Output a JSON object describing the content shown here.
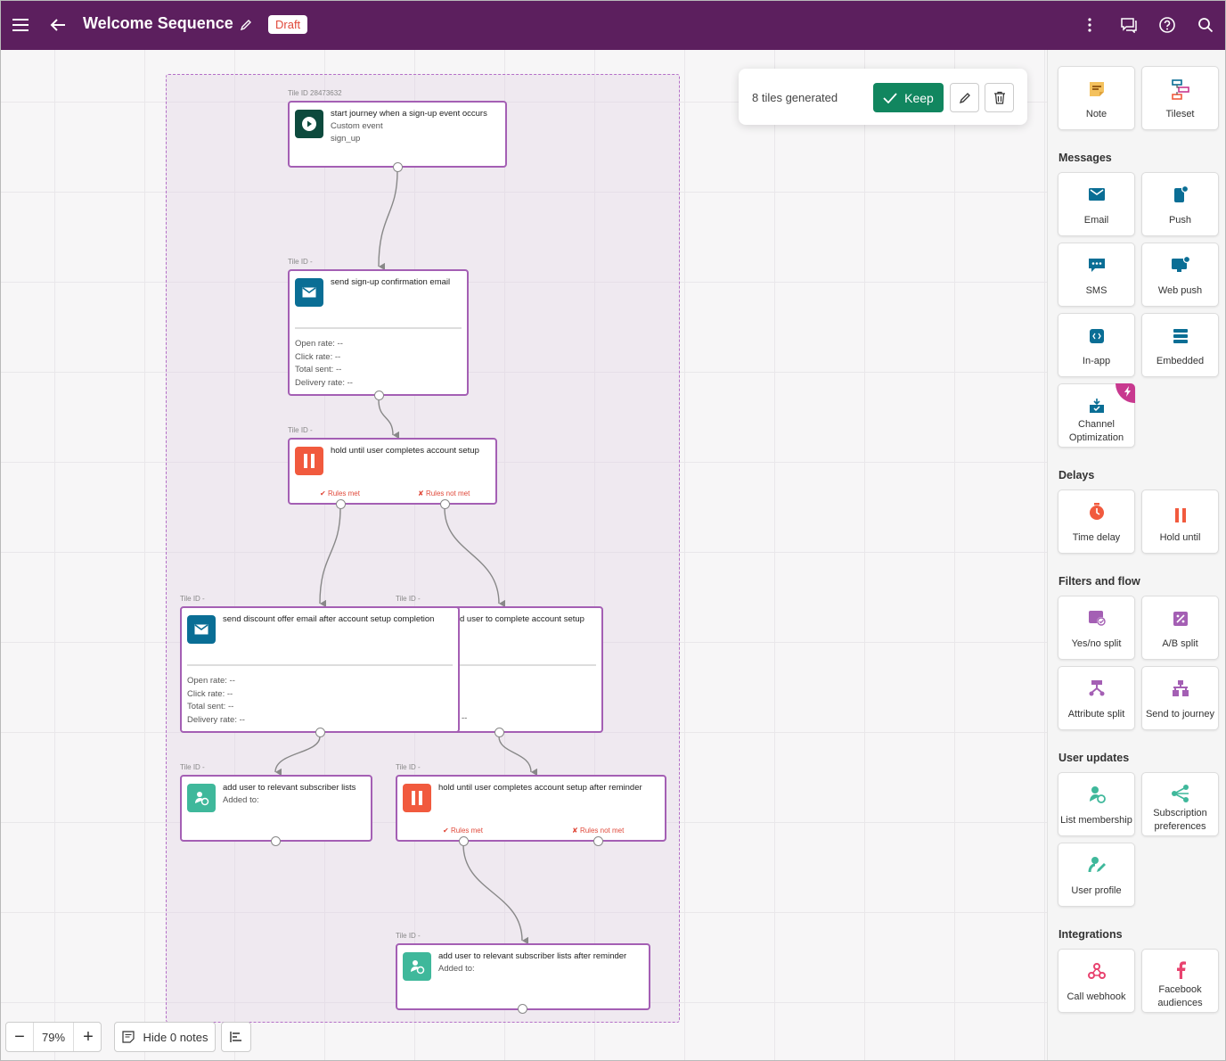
{
  "header": {
    "title": "Welcome Sequence",
    "status": "Draft"
  },
  "popup": {
    "text": "8 tiles generated",
    "keep_label": "Keep"
  },
  "tiles": [
    {
      "tile_id": "Tile ID 28473632",
      "title": "start journey when a sign-up event occurs",
      "sub1": "Custom event",
      "sub2": "sign_up"
    },
    {
      "tile_id": "Tile ID -",
      "title": "send sign-up confirmation email",
      "stats": [
        "Open rate:  --",
        "Click rate:  --",
        "Total sent:  --",
        "Delivery rate:  --"
      ]
    },
    {
      "tile_id": "Tile ID -",
      "title": "hold until user completes account setup",
      "rules_met": "Rules met",
      "rules_not_met": "Rules not met"
    },
    {
      "tile_id": "Tile ID -",
      "title": "send discount offer email after account setup completion",
      "stats": [
        "Open rate:  --",
        "Click rate:  --",
        "Total sent:  --",
        "Delivery rate:  --"
      ]
    },
    {
      "tile_id": "Tile ID -",
      "title": "d user to complete account setup",
      "partial": "--"
    },
    {
      "tile_id": "Tile ID -",
      "title": "add user to relevant subscriber lists",
      "sub1": "Added to:"
    },
    {
      "tile_id": "Tile ID -",
      "title": "hold until user completes account setup after reminder",
      "rules_met": "Rules met",
      "rules_not_met": "Rules not met"
    },
    {
      "tile_id": "Tile ID -",
      "title": "add user to relevant subscriber lists after reminder",
      "sub1": "Added to:"
    }
  ],
  "toolbar": {
    "zoom": "79%",
    "hide_notes": "Hide 0 notes"
  },
  "sidebar": {
    "top": [
      "Note",
      "Tileset"
    ],
    "sections": [
      "Messages",
      "Delays",
      "Filters and flow",
      "User updates",
      "Integrations"
    ],
    "messages": [
      "Email",
      "Push",
      "SMS",
      "Web push",
      "In-app",
      "Embedded",
      "Channel Optimization"
    ],
    "delays": [
      "Time delay",
      "Hold until"
    ],
    "filters": [
      "Yes/no split",
      "A/B split",
      "Attribute split",
      "Send to journey"
    ],
    "user_updates": [
      "List membership",
      "Subscription preferences",
      "User profile"
    ],
    "integrations": [
      "Call webhook",
      "Facebook audiences"
    ]
  },
  "colors": {
    "header_bg": "#5c1f5e",
    "tile_border": "#a45fb4",
    "accent_green": "#11865f",
    "email_blue": "#0a6e95",
    "hold_orange": "#f15a3e",
    "list_green": "#3fb89b",
    "start_dark": "#0d4a3d"
  }
}
